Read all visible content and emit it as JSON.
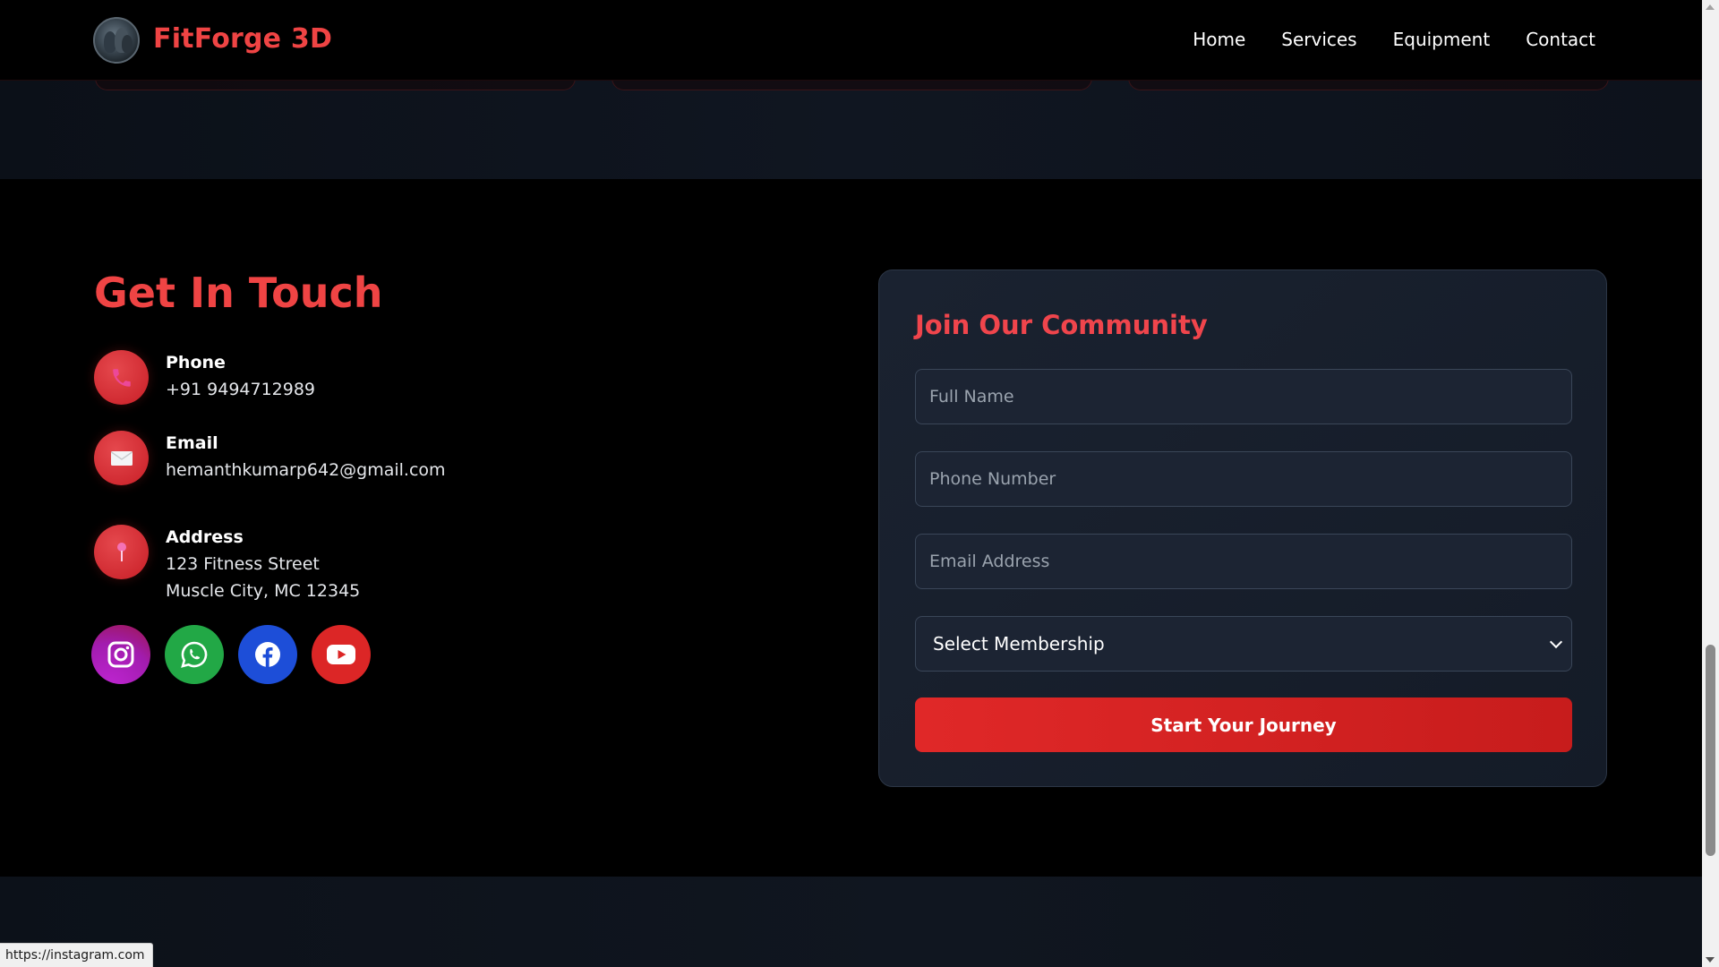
{
  "brand": {
    "name": "FitForge 3D",
    "logo_icon": "avatar-logo"
  },
  "nav": {
    "items": [
      {
        "label": "Home"
      },
      {
        "label": "Services"
      },
      {
        "label": "Equipment"
      },
      {
        "label": "Contact"
      }
    ]
  },
  "contact": {
    "title": "Get In Touch",
    "phone": {
      "label": "Phone",
      "value": "+91 9494712989",
      "icon": "phone-icon"
    },
    "email": {
      "label": "Email",
      "value": "hemanthkumarp642@gmail.com",
      "icon": "envelope-icon"
    },
    "address": {
      "label": "Address",
      "line1": "123 Fitness Street",
      "line2": "Muscle City, MC 12345",
      "icon": "pin-icon"
    },
    "socials": [
      {
        "name": "instagram-icon",
        "color": "#c026d3"
      },
      {
        "name": "whatsapp-icon",
        "color": "#22a846"
      },
      {
        "name": "facebook-icon",
        "color": "#1d4ed8"
      },
      {
        "name": "youtube-icon",
        "color": "#dc2626"
      }
    ]
  },
  "form": {
    "title": "Join Our Community",
    "full_name_placeholder": "Full Name",
    "phone_placeholder": "Phone Number",
    "email_placeholder": "Email Address",
    "membership_selected": "Select Membership",
    "submit_label": "Start Your Journey"
  },
  "status_bar": {
    "url": "https://instagram.com"
  },
  "colors": {
    "accent": "#ef4444",
    "background": "#000000",
    "card": "#1a2230"
  }
}
